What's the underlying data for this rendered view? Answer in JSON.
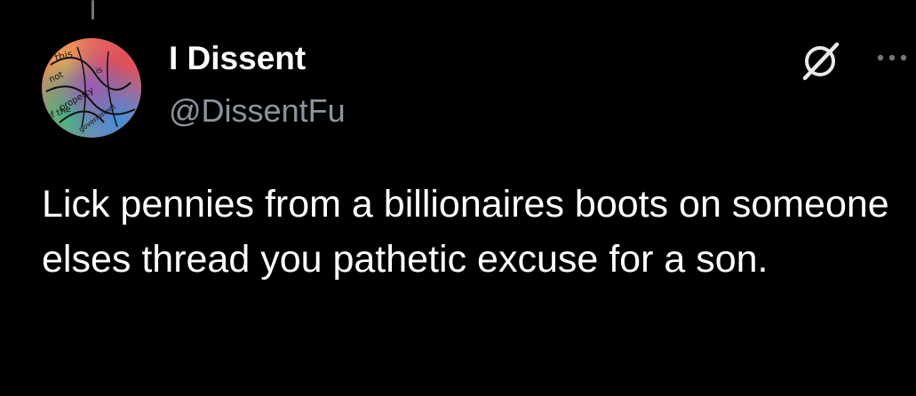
{
  "post": {
    "author": {
      "display_name": "I Dissent",
      "handle": "@DissentFu",
      "avatar_text": [
        "this",
        "is",
        "not",
        "property",
        "of the",
        "government"
      ]
    },
    "text": "Lick pennies from a billionaires boots on someone elses thread you pathetic excuse for a son."
  },
  "icons": {
    "grok": "grok-icon",
    "more": "more-options-icon"
  },
  "colors": {
    "background": "#000000",
    "text_primary": "#ffffff",
    "text_secondary": "#8b949e"
  }
}
